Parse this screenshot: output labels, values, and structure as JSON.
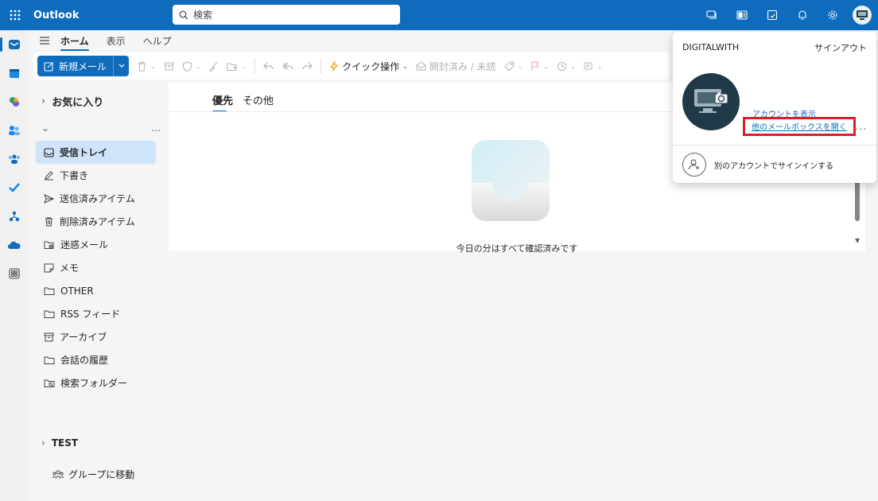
{
  "app": {
    "title": "Outlook"
  },
  "search": {
    "placeholder": "検索"
  },
  "ribbon": {
    "tabs": [
      "ホーム",
      "表示",
      "ヘルプ"
    ],
    "new_mail": "新規メール",
    "quick_steps": "クイック操作",
    "read_unread": "開封済み / 未読"
  },
  "folders": {
    "favorites": "お気に入り",
    "account_more": "...",
    "items": [
      {
        "label": "受信トレイ",
        "icon": "inbox-icon"
      },
      {
        "label": "下書き",
        "icon": "draft-icon"
      },
      {
        "label": "送信済みアイテム",
        "icon": "send-icon"
      },
      {
        "label": "削除済みアイテム",
        "icon": "trash-icon"
      },
      {
        "label": "迷惑メール",
        "icon": "junk-icon"
      },
      {
        "label": "メモ",
        "icon": "note-icon"
      },
      {
        "label": "OTHER",
        "icon": "folder-icon"
      },
      {
        "label": "RSS フィード",
        "icon": "folder-icon"
      },
      {
        "label": "アーカイブ",
        "icon": "archive-icon"
      },
      {
        "label": "会話の履歴",
        "icon": "folder-icon"
      },
      {
        "label": "検索フォルダー",
        "icon": "search-folder-icon"
      }
    ],
    "test_group": "TEST",
    "go_to_groups": "グループに移動"
  },
  "message_list": {
    "tab_focused": "優先",
    "tab_other": "その他",
    "empty_message": "今日の分はすべて確認済みです"
  },
  "account_flyout": {
    "org": "DIGITALWITH",
    "sign_out": "サインアウト",
    "view_account": "アカウントを表示",
    "open_other_mailbox": "他のメールボックスを開く",
    "more": "...",
    "sign_in_other": "別のアカウントでサインインする"
  },
  "colors": {
    "brand": "#0f6cbd",
    "highlight_box": "#d9202a"
  }
}
